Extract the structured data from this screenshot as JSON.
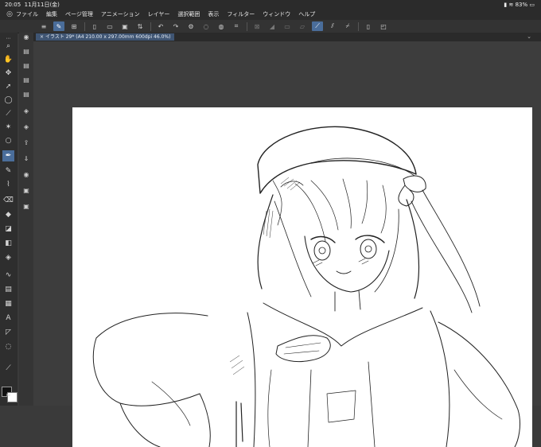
{
  "status": {
    "time": "20:05",
    "date": "11月11日(金)",
    "battery": "83%"
  },
  "menu": [
    "ファイル",
    "編集",
    "ページ管理",
    "アニメーション",
    "レイヤー",
    "選択範囲",
    "表示",
    "フィルター",
    "ウィンドウ",
    "ヘルプ"
  ],
  "document": {
    "tab_label": "イラスト 29* (A4 210.00 x 297.00mm 600dpi 46.0%)"
  },
  "colors": {
    "accent": "#4a6d9a",
    "foreground": "#111111",
    "background": "#ffffff"
  }
}
